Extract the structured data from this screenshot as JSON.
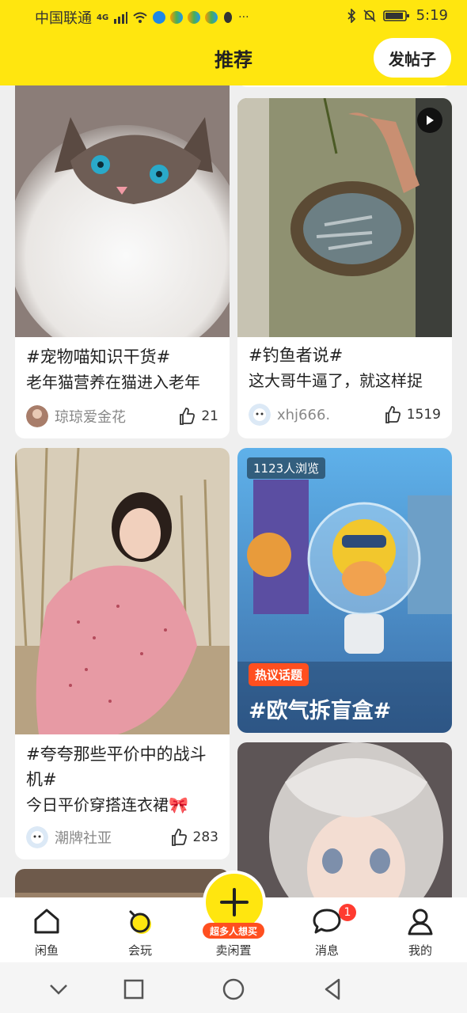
{
  "status": {
    "carrier": "中国联通",
    "net": "4G",
    "more": "···",
    "time": "5:19"
  },
  "header": {
    "title": "推荐",
    "post_button": "发帖子"
  },
  "cards": [
    {
      "tag": "#宠物喵知识干货#",
      "desc": "老年猫营养在猫进入老年",
      "author": "琼琼爱金花",
      "likes": "21"
    },
    {
      "tag": "#钓鱼者说#",
      "desc": "这大哥牛逼了，就这样捉",
      "author": "xhj666.",
      "likes": "1519"
    },
    {
      "tag1": "#夸夸那些平价中的战斗",
      "tag2": "机#",
      "desc": "今日平价穿搭连衣裙🎀",
      "author": "潮牌社亚",
      "likes": "283"
    },
    {
      "views": "1123人浏览",
      "hot_label": "热议话题",
      "topic": "#欧气拆盲盒#"
    }
  ],
  "tabs": {
    "home": "闲鱼",
    "play": "会玩",
    "sell": "卖闲置",
    "sell_promo": "超多人想买",
    "messages": "消息",
    "messages_badge": "1",
    "me": "我的"
  }
}
